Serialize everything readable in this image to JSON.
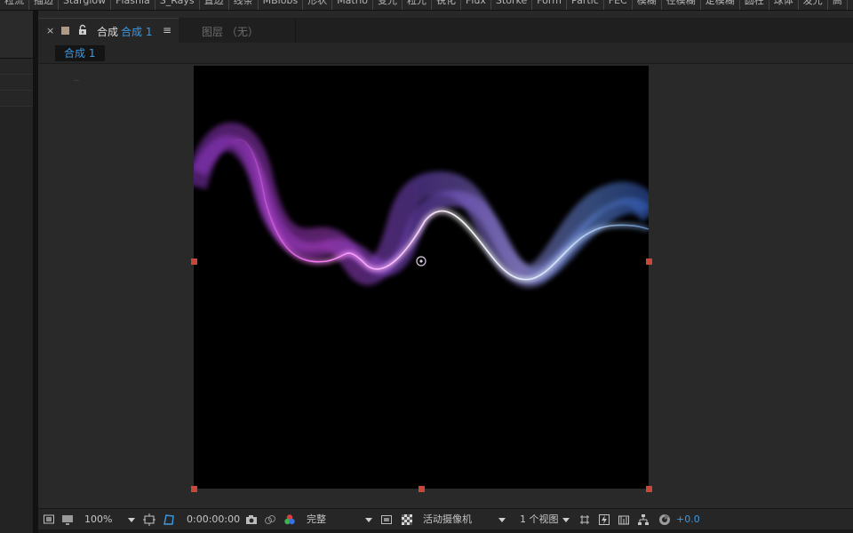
{
  "toolbar": {
    "buttons": [
      "粒流",
      "描边",
      "Starglow",
      "Flashla",
      "S_Rays",
      "置边",
      "线条",
      "MBlobs",
      "形状",
      "Matrio",
      "变光",
      "粒光",
      "锐化",
      "Flux",
      "Storke",
      "Form",
      "Partic",
      "FEC",
      "模糊",
      "径模糊",
      "定模糊",
      "圆柱",
      "球体",
      "发光",
      "高"
    ]
  },
  "viewer": {
    "tab": {
      "close": "×",
      "label": "合成",
      "comp_name": "合成 1",
      "menu": "≡"
    },
    "layer_tab": "图层 （无）",
    "breadcrumb": "合成 1"
  },
  "controls": {
    "zoom": "100%",
    "timecode": "0:00:00:00",
    "resolution": "完整",
    "camera": "活动摄像机",
    "views": "1 个视图",
    "exposure": "+0.0"
  },
  "colors": {
    "accent": "#3d9ae0",
    "handle": "#c8473a",
    "label_swatch": "#b09a86"
  },
  "icons": {
    "lock": "lock-icon",
    "monitor": "monitor-icon",
    "snapshot": "camera-icon",
    "channels": "color-channels-icon",
    "transparency": "transparency-grid-icon"
  }
}
